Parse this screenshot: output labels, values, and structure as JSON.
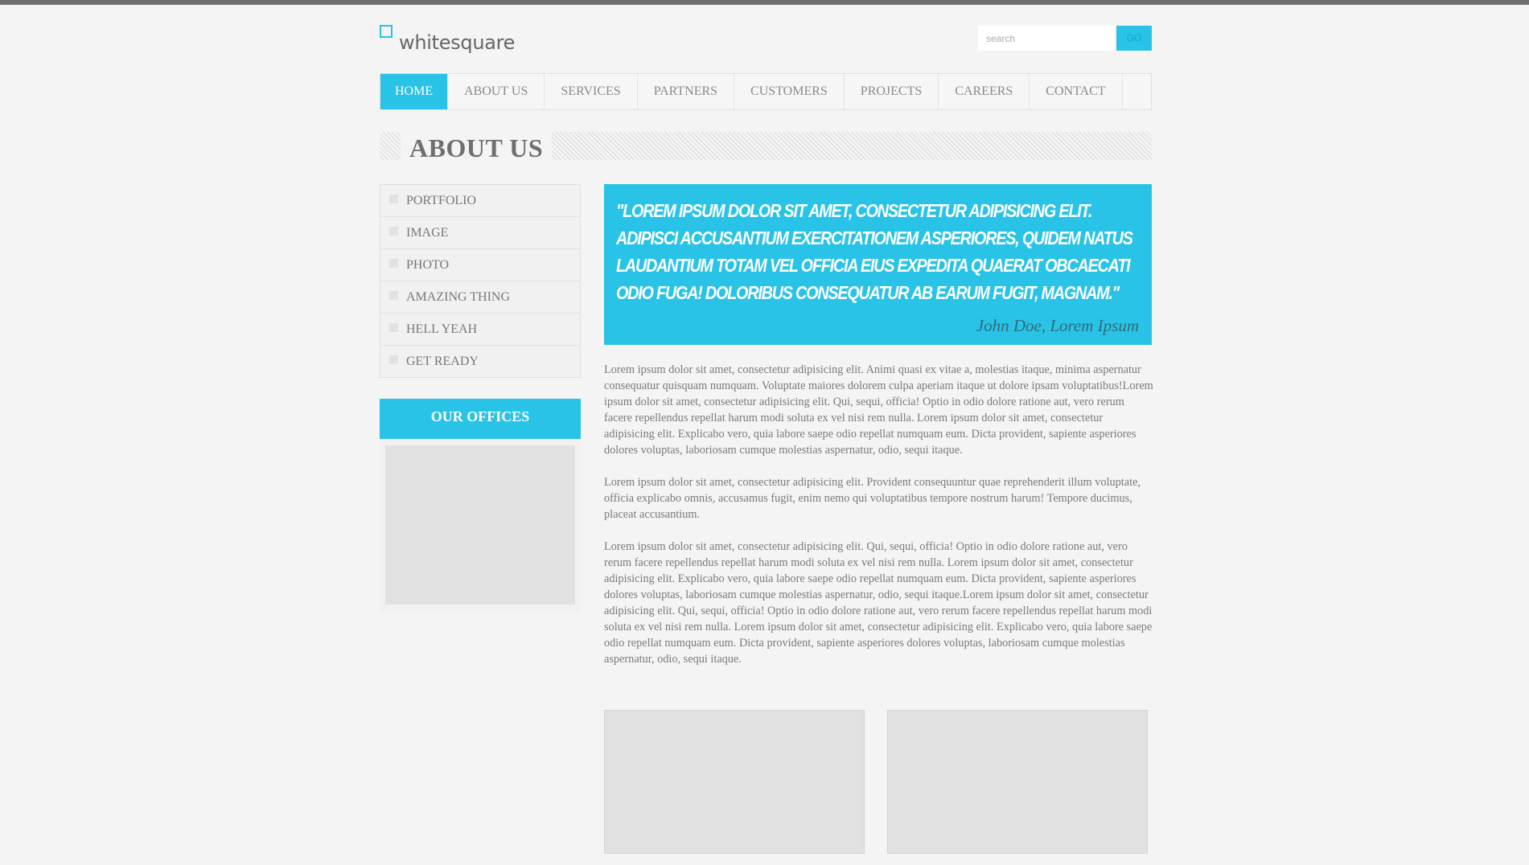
{
  "header": {
    "logo_text": "whitesquare",
    "search_placeholder": "search",
    "go_label": "GO"
  },
  "nav": {
    "items": [
      {
        "label": "HOME"
      },
      {
        "label": "ABOUT US"
      },
      {
        "label": "SERVICES"
      },
      {
        "label": "PARTNERS"
      },
      {
        "label": "CUSTOMERS"
      },
      {
        "label": "PROJECTS"
      },
      {
        "label": "CAREERS"
      },
      {
        "label": "CONTACT"
      }
    ]
  },
  "page": {
    "title": "ABOUT US"
  },
  "sidebar": {
    "items": [
      {
        "label": "PORTFOLIO"
      },
      {
        "label": "IMAGE"
      },
      {
        "label": "PHOTO"
      },
      {
        "label": "AMAZING THING"
      },
      {
        "label": "HELL YEAH"
      },
      {
        "label": "GET READY"
      }
    ],
    "offices_title": "OUR OFFICES"
  },
  "quote": {
    "text": "\"Lorem ipsum dolor sit amet, consectetur adipisicing elit. Adipisci accusantium exercitationem asperiores, quidem natus laudantium totam vel officia eius expedita quaerat obcaecati odio fuga! Doloribus consequatur ab earum fugit, magnam.\"",
    "author": "John Doe, Lorem Ipsum"
  },
  "content": {
    "paragraphs": [
      "Lorem ipsum dolor sit amet, consectetur adipisicing elit. Animi quasi ex vitae a, molestias itaque, minima aspernatur consequatur quisquam numquam. Voluptate maiores dolorem culpa aperiam itaque ut dolore ipsam voluptatibus!Lorem ipsum dolor sit amet, consectetur adipisicing elit. Qui, sequi, officia! Optio in odio dolore ratione aut, vero rerum facere repellendus repellat harum modi soluta ex vel nisi rem nulla. Lorem ipsum dolor sit amet, consectetur adipisicing elit. Explicabo vero, quia labore saepe odio repellat numquam eum. Dicta provident, sapiente asperiores dolores voluptas, laboriosam cumque molestias aspernatur, odio, sequi itaque.",
      "Lorem ipsum dolor sit amet, consectetur adipisicing elit. Provident consequuntur quae reprehenderit illum voluptate, officia explicabo omnis, accusamus fugit, enim nemo qui voluptatibus tempore nostrum harum! Tempore ducimus, placeat accusantium.",
      "Lorem ipsum dolor sit amet, consectetur adipisicing elit. Qui, sequi, officia! Optio in odio dolore ratione aut, vero rerum facere repellendus repellat harum modi soluta ex vel nisi rem nulla. Lorem ipsum dolor sit amet, consectetur adipisicing elit. Explicabo vero, quia labore saepe odio repellat numquam eum. Dicta provident, sapiente asperiores dolores voluptas, laboriosam cumque molestias aspernatur, odio, sequi itaque.Lorem ipsum dolor sit amet, consectetur adipisicing elit. Qui, sequi, officia! Optio in odio dolore ratione aut, vero rerum facere repellendus repellat harum modi soluta ex vel nisi rem nulla. Lorem ipsum dolor sit amet, consectetur adipisicing elit. Explicabo vero, quia labore saepe odio repellat numquam eum. Dicta provident, sapiente asperiores dolores voluptas, laboriosam cumque molestias aspernatur, odio, sequi itaque."
    ]
  },
  "colors": {
    "accent": "#28c3e7",
    "text": "#777777",
    "background": "#f4f4f4"
  }
}
